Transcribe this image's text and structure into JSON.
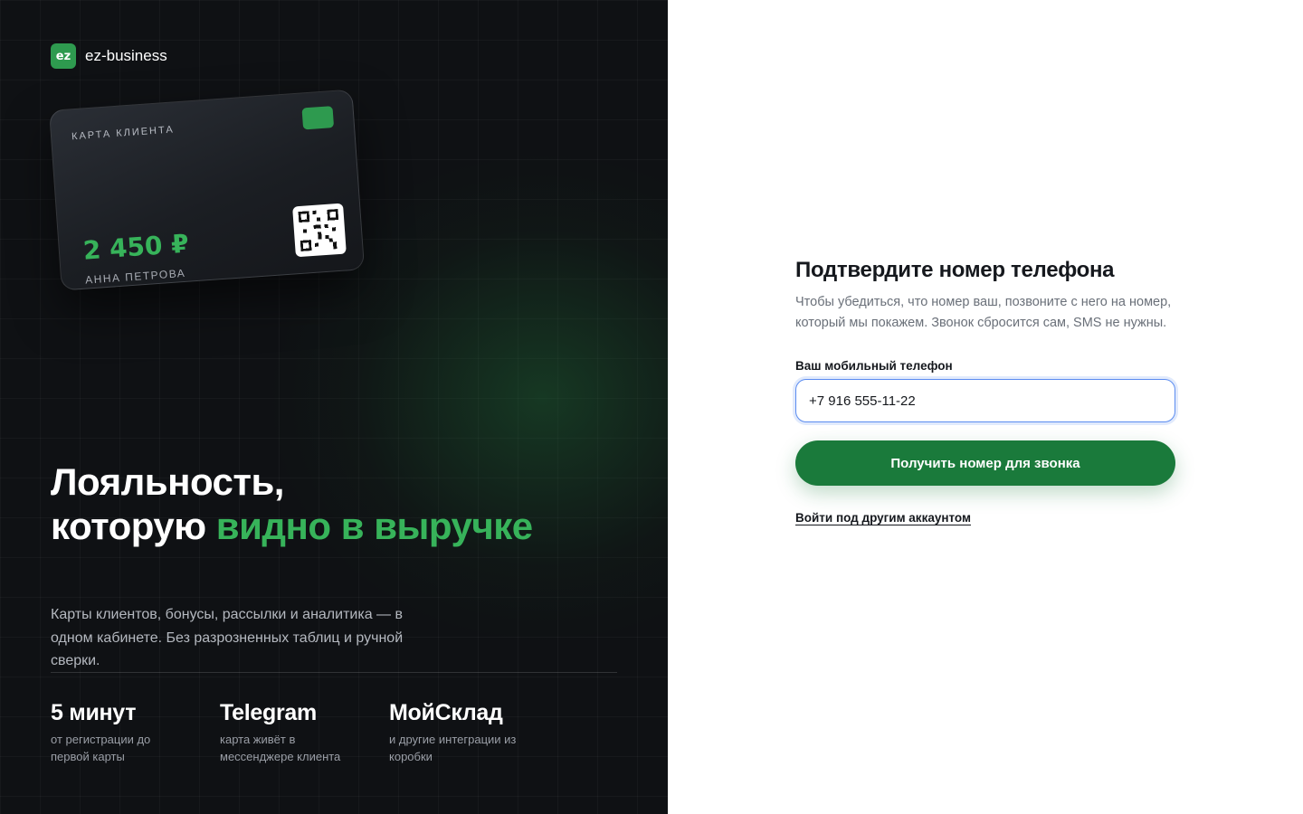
{
  "brand": {
    "logo_text": "ez",
    "name": "ez-business"
  },
  "card": {
    "title": "КАРТА КЛИЕНТА",
    "amount": "2 450 ₽",
    "holder": "АННА ПЕТРОВА"
  },
  "hero": {
    "headline_line1": "Лояльность,",
    "headline_line2": "которую ",
    "headline_accent": "видно в выручке",
    "description": "Карты клиентов, бонусы, рассылки и аналитика — в одном кабинете. Без разрозненных таблиц и ручной сверки."
  },
  "stats": [
    {
      "title": "5 минут",
      "subtitle": "от регистрации до первой карты"
    },
    {
      "title": "Telegram",
      "subtitle": "карта живёт в мессенджере клиента"
    },
    {
      "title": "МойСклад",
      "subtitle": "и другие интеграции из коробки"
    }
  ],
  "form": {
    "title": "Подтвердите номер телефона",
    "description": "Чтобы убедиться, что номер ваш, позвоните с него на номер, который мы покажем. Звонок сбросится сам, SMS не нужны.",
    "phone_label": "Ваш мобильный телефон",
    "phone_value": "+7 916 555-11-22",
    "submit_label": "Получить номер для звонка",
    "switch_account_label": "Войти под другим аккаунтом"
  },
  "colors": {
    "accent": "#37b35a",
    "button": "#1a7a3b",
    "left_bg": "#0f1114",
    "focus_ring": "#5b8cf0"
  }
}
